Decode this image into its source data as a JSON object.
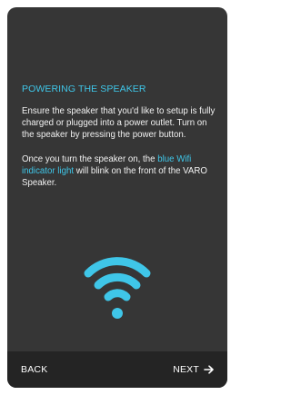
{
  "section": {
    "title": "POWERING THE SPEAKER",
    "paragraph1": "Ensure the speaker that you'd like to setup is fully charged or plugged into a power outlet. Turn on the speaker by pressing the power button.",
    "paragraph2_before": "Once you turn the speaker on, the ",
    "paragraph2_highlight": "blue Wifi indicator light",
    "paragraph2_after": " will blink on the front of the VARO Speaker."
  },
  "illustration": {
    "icon": "wifi-icon",
    "color": "#3fc6e8"
  },
  "navigation": {
    "back_label": "BACK",
    "next_label": "NEXT",
    "next_icon": "arrow-right-icon"
  },
  "colors": {
    "background": "#363636",
    "bottom_bar": "#242424",
    "accent": "#3fc6e8",
    "text": "#f2f2f2"
  }
}
